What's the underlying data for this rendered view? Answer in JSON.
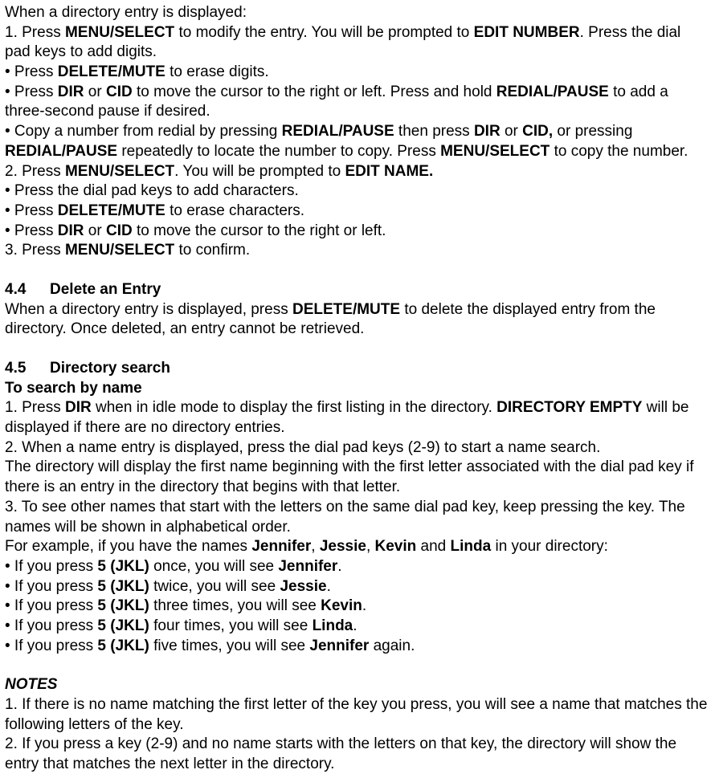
{
  "p1": "When a directory entry is displayed:",
  "p2a": "1. Press ",
  "p2b": "MENU/SELECT",
  "p2c": " to modify the entry. You will be prompted to ",
  "p2d": "EDIT NUMBER",
  "p2e": ". Press the dial pad keys to add digits.",
  "p3a": "• Press ",
  "p3b": "DELETE/MUTE",
  "p3c": " to erase digits.",
  "p4a": "• Press ",
  "p4b": "DIR",
  "p4c": " or ",
  "p4d": "CID",
  "p4e": " to move the cursor to the right or left. Press and hold ",
  "p4f": "REDIAL/PAUSE",
  "p4g": " to add a three-second pause if desired.",
  "p5a": "• Copy a number from redial by pressing ",
  "p5b": "REDIAL/PAUSE",
  "p5c": " then press ",
  "p5d": "DIR",
  "p5e": " or ",
  "p5f": "CID,",
  "p5g": " or pressing ",
  "p5h": "REDIAL/PAUSE",
  "p5i": " repeatedly to locate the number to copy. Press ",
  "p5j": "MENU/SELECT",
  "p5k": " to copy the number.",
  "p6a": "2. Press ",
  "p6b": "MENU/SELECT",
  "p6c": ". You will be prompted to ",
  "p6d": "EDIT NAME.",
  "p7": "• Press the dial pad keys to add characters.",
  "p8a": "• Press ",
  "p8b": "DELETE/MUTE",
  "p8c": " to erase characters.",
  "p9a": "• Press ",
  "p9b": "DIR",
  "p9c": " or ",
  "p9d": "CID",
  "p9e": " to move the cursor to the right or left.",
  "p10a": "3. Press ",
  "p10b": "MENU/SELECT",
  "p10c": " to confirm.",
  "s44num": "4.4",
  "s44title": "Delete an Entry",
  "p11a": "When a directory entry is displayed, press ",
  "p11b": "DELETE/MUTE",
  "p11c": " to delete the displayed entry from the directory. Once deleted, an entry cannot be retrieved.",
  "s45num": "4.5",
  "s45title": "Directory search",
  "p12": "To search by name",
  "p13a": "1. Press ",
  "p13b": "DIR",
  "p13c": " when in idle mode to display the first listing in the directory. ",
  "p13d": "DIRECTORY EMPTY",
  "p13e": " will be displayed if there are no directory entries.",
  "p14": "2. When a name entry is displayed, press the dial pad keys (2-9) to start a name search.",
  "p15": "The directory will display the first name beginning with the first letter associated with the dial pad key if there is an entry in the directory that begins with that letter.",
  "p16": "3. To see other names that start with the letters on the same dial pad key, keep pressing the key. The names will be shown in alphabetical order.",
  "p17a": "For example, if you have the names ",
  "p17b": "Jennifer",
  "p17c": ", ",
  "p17d": "Jessie",
  "p17e": ", ",
  "p17f": "Kevin",
  "p17g": " and ",
  "p17h": "Linda",
  "p17i": " in your directory:",
  "p18a": "• If you press ",
  "p18b": "5 (JKL)",
  "p18c": " once, you will see ",
  "p18d": "Jennifer",
  "p18e": ".",
  "p19a": "• If you press ",
  "p19b": "5 (JKL)",
  "p19c": " twice, you will see ",
  "p19d": "Jessie",
  "p19e": ".",
  "p20a": "• If you press ",
  "p20b": "5 (JKL)",
  "p20c": " three times, you will see ",
  "p20d": "Kevin",
  "p20e": ".",
  "p21a": "• If you press ",
  "p21b": "5 (JKL)",
  "p21c": " four times, you will see ",
  "p21d": "Linda",
  "p21e": ".",
  "p22a": "• If you press ",
  "p22b": "5 (JKL)",
  "p22c": " five times, you will see ",
  "p22d": "Jennifer",
  "p22e": " again.",
  "notes": "NOTES",
  "n1": "1. If there is no name matching the first letter of the key you press, you will see a name that matches the following letters of the key.",
  "n2": "2. If you press a key (2-9) and no name starts with the letters on that key, the directory will show the entry that matches the next letter in the directory."
}
